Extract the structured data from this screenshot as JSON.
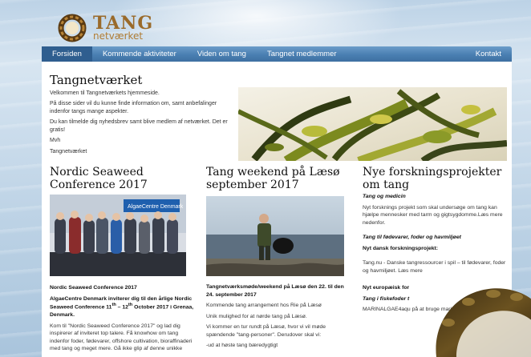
{
  "logo": {
    "name": "TANG",
    "sub": "netværket"
  },
  "nav": {
    "items": [
      "Forsiden",
      "Kommende aktiviteter",
      "Viden om tang",
      "Tangnet medlemmer"
    ],
    "right": "Kontakt",
    "active_index": 0
  },
  "intro": {
    "title": "Tangnetværket",
    "p1": "Velkommen til Tangnetværkets hjemmeside.",
    "p2": "På disse sider vil du kunne finde information om, samt anbefalinger indenfor tangs mange aspekter.",
    "p3": "Du kan tilmelde dig nyhedsbrev samt blive medlem af netværket. Det er gratis!",
    "p4": "Mvh",
    "p5": "Tangnetværket"
  },
  "col1": {
    "title": "Nordic Seaweed Conference 2017",
    "photo_sign": "AlgaeCentre Denmark",
    "heading1": "Nordic Seaweed Conference 2017",
    "heading2a": "AlgaeCentre Denmark inviterer dig til den årlige Nordic Seaweed Conference 11",
    "heading2b": "th",
    "heading2c": " – 12",
    "heading2d": "th",
    "heading2e": " October 2017 i Grenaa, Denmark.",
    "body": "Kom til \"Nordic Seaweed Conference 2017\" og lad dig inspirerer af inviteret top talere. Få knowhow om tang indenfor foder, fødevarer, offshore cultivation, bioraffinaderi med tang og meget mere. Gå ikke glip af denne unikke"
  },
  "col2": {
    "title": "Tang weekend på Læsø september 2017",
    "heading": "Tangnetværksmøde/weekend på Læsø den 22. til den 24. september 2017",
    "p1": "Kommende tang arrangement hos Rie på Læsø",
    "p2": "Unik mulighed for at nørde tang på Læsø.",
    "p3": "Vi kommer en tur rundt på Læsø, hvor vi vil møde spændende \"tang-personer\". Derudover skal vi:",
    "p4": "-ud at høste tang bæredygtigt"
  },
  "col3": {
    "title": "Nye forskningsprojekter om tang",
    "sub1": "Tang og medicin",
    "p1": "Nyt forsknings projekt som skal undersøge om tang kan hjælpe mennesker med tarm og gigtsygdomme.Læs mere nedenfor.",
    "sub2": "Tang til fødevarer, foder og havmiljøet",
    "sub2b": "Nyt dansk forskningsprojekt:",
    "p2": "Tang.nu - Danske tangressourcer i spil – til fødevarer, foder og havmiljøet. Læs mere",
    "sub3": "Nyt europæisk for",
    "sub3b": "Tang i fiskefoder t",
    "p3": "MARINALGAE4aqu på at bruge marine foderingrediens, for"
  },
  "colors": {
    "nav": "#4a7fb2",
    "nav_active": "#2f5e8f",
    "logo": "#9a6a2a"
  }
}
